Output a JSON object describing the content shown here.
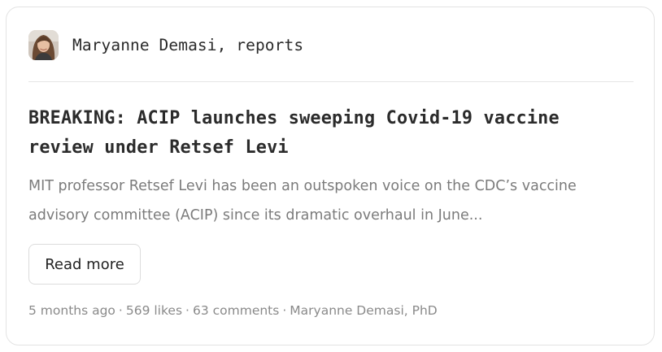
{
  "post": {
    "publication": "Maryanne Demasi, reports",
    "avatar_icon": "author-portrait",
    "title": "BREAKING: ACIP launches sweeping Covid-19 vaccine review under Retsef Levi",
    "excerpt": "MIT professor Retsef Levi has been an outspoken voice on the CDC’s vaccine advisory committee (ACIP) since its dramatic overhaul in June...",
    "read_more_label": "Read more",
    "meta": {
      "age": "5 months ago",
      "likes": "569 likes",
      "comments": "63 comments",
      "author": "Maryanne Demasi, PhD",
      "separator": "·"
    }
  },
  "colors": {
    "border": "#e3e3e3",
    "title": "#2b2b2b",
    "excerpt": "#7b7b7b",
    "meta": "#8a8a8a"
  }
}
